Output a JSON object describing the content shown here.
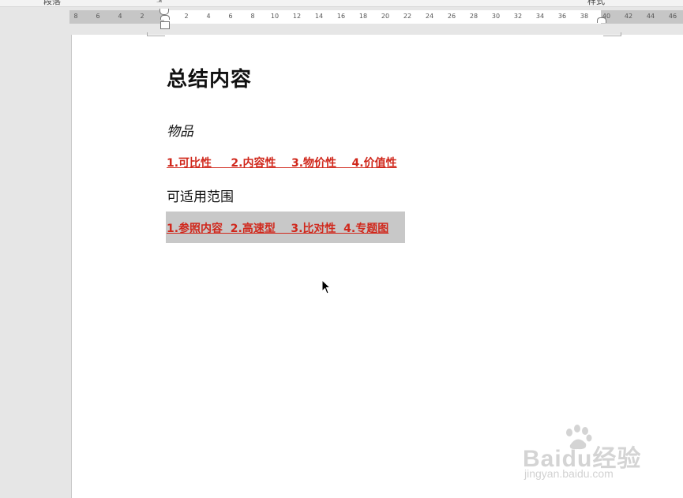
{
  "ribbon": {
    "left_label": "段落",
    "right_label": "样式"
  },
  "ruler": {
    "ticks": [
      "8",
      "6",
      "4",
      "2",
      "2",
      "4",
      "6",
      "8",
      "10",
      "12",
      "14",
      "16",
      "18",
      "20",
      "22",
      "24",
      "26",
      "28",
      "30",
      "32",
      "34",
      "36",
      "38",
      "40",
      "42",
      "44",
      "46"
    ]
  },
  "document": {
    "title": "总结内容",
    "line1": "物品",
    "line2": "1.可比性     2.内容性    3.物价性    4.价值性",
    "line3": "可适用范围",
    "line4": "1.参照内容  2.高速型    3.比对性  4.专题图"
  },
  "watermark": {
    "brand": "Baidu经验",
    "url": "jingyan.baidu.com"
  }
}
